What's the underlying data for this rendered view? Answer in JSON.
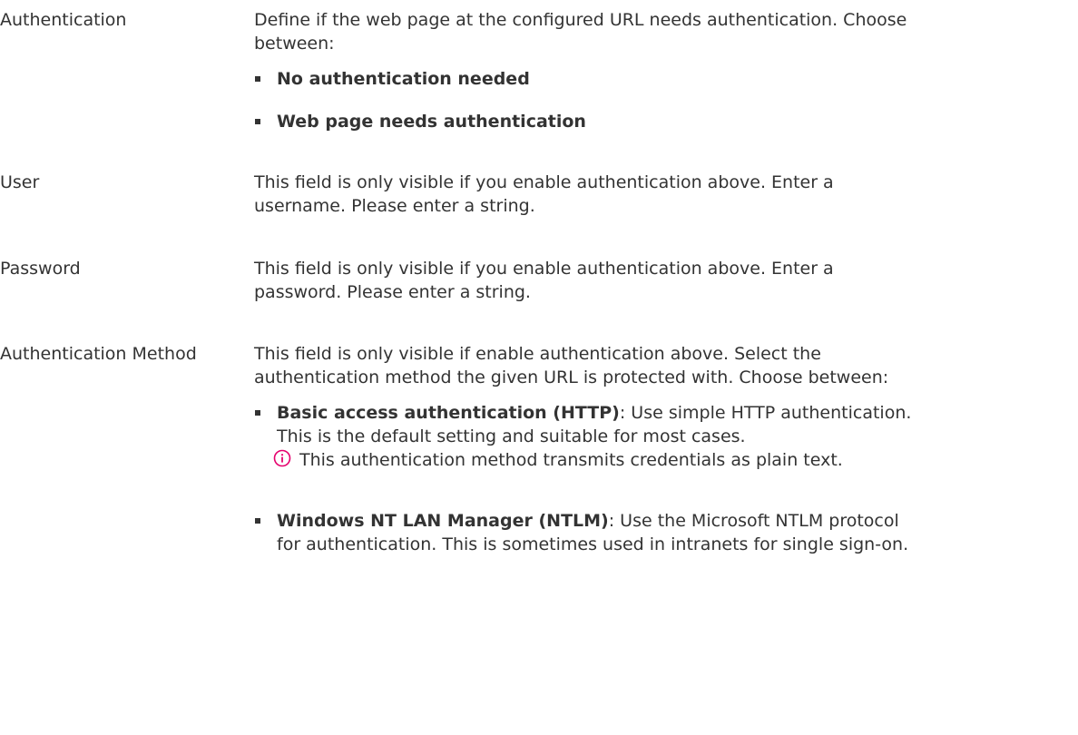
{
  "rows": [
    {
      "term": "Authentication",
      "description": "Define if the web page at the configured URL needs authentication. Choose between:",
      "options": [
        {
          "title": "No authentication needed"
        },
        {
          "title": "Web page needs authentication"
        }
      ]
    },
    {
      "term": "User",
      "description": "This field is only visible if you enable authentication above. Enter a username. Please enter a string."
    },
    {
      "term": "Password",
      "description": "This field is only visible if you enable authentication above. Enter a password. Please enter a string."
    },
    {
      "term": "Authentication Method",
      "description": "This field is only visible if enable authentication above. Select the authentication method the given URL is protected with. Choose between:",
      "options": [
        {
          "title": "Basic access authentication (HTTP)",
          "text": ": Use simple HTTP authentication. This is the default setting and suitable for most cases.",
          "note": "This authentication method transmits credentials as plain text.",
          "note_icon": "info-icon"
        },
        {
          "title": "Windows NT LAN Manager (NTLM)",
          "text": ": Use the Microsoft NTLM protocol for authentication. This is sometimes used in intranets for single sign-on."
        }
      ]
    }
  ],
  "colors": {
    "text": "#333333",
    "info_icon": "#e5006d"
  }
}
